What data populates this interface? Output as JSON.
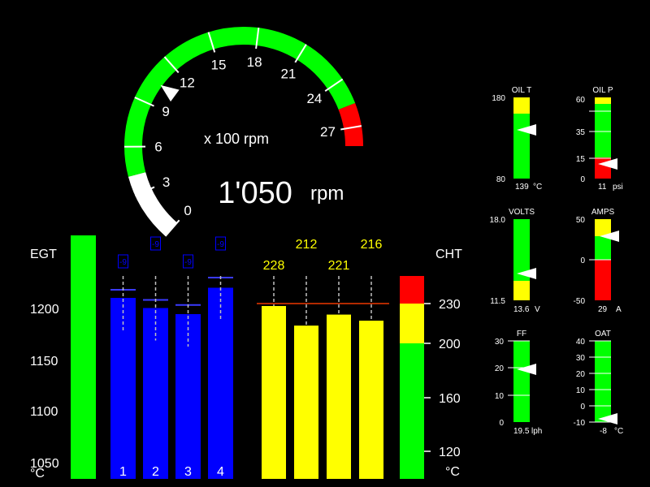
{
  "rpm": {
    "unit_caption": "x 100 rpm",
    "value": "1'050",
    "unit": "rpm",
    "ticks": [
      "0",
      "3",
      "6",
      "9",
      "12",
      "15",
      "18",
      "21",
      "24",
      "27"
    ],
    "pointer_value": 10.5
  },
  "egt": {
    "title": "EGT",
    "unit": "°C",
    "scale": [
      "1200",
      "1150",
      "1100",
      "1050"
    ],
    "cylinders": [
      "1",
      "2",
      "3",
      "4"
    ],
    "values": [
      1212,
      1202,
      1196,
      1222
    ],
    "peaks": [
      1220,
      1210,
      1205,
      1232
    ],
    "flags": [
      "-9",
      "-9",
      "-9",
      "-9"
    ]
  },
  "cht": {
    "title": "CHT",
    "unit": "°C",
    "scale": [
      "230",
      "200",
      "160",
      "120"
    ],
    "values": [
      "228",
      "212",
      "221",
      "216"
    ],
    "numeric": [
      228,
      212,
      221,
      216
    ],
    "limit": 230
  },
  "gauges": {
    "oil_t": {
      "label": "OIL T",
      "max": "180",
      "min": "80",
      "reading": "139",
      "unit": "°C"
    },
    "oil_p": {
      "label": "OIL P",
      "ticks": [
        "60",
        "35",
        "15",
        "0"
      ],
      "reading": "11",
      "unit": "psi"
    },
    "volts": {
      "label": "VOLTS",
      "max": "18.0",
      "min": "11.5",
      "reading": "13.6",
      "unit": "V"
    },
    "amps": {
      "label": "AMPS",
      "ticks": [
        "50",
        "0",
        "-50"
      ],
      "reading": "29",
      "unit": "A"
    },
    "ff": {
      "label": "FF",
      "ticks": [
        "30",
        "20",
        "10",
        "0"
      ],
      "reading": "19.5",
      "unit": "lph"
    },
    "oat": {
      "label": "OAT",
      "ticks": [
        "40",
        "30",
        "20",
        "10",
        "0",
        "-10"
      ],
      "reading": "-8",
      "unit": "°C"
    }
  },
  "colors": {
    "green": "#00ff00",
    "red": "#ff0000",
    "yellow": "#ffff00",
    "blue": "#0000ff",
    "white": "#ffffff"
  }
}
